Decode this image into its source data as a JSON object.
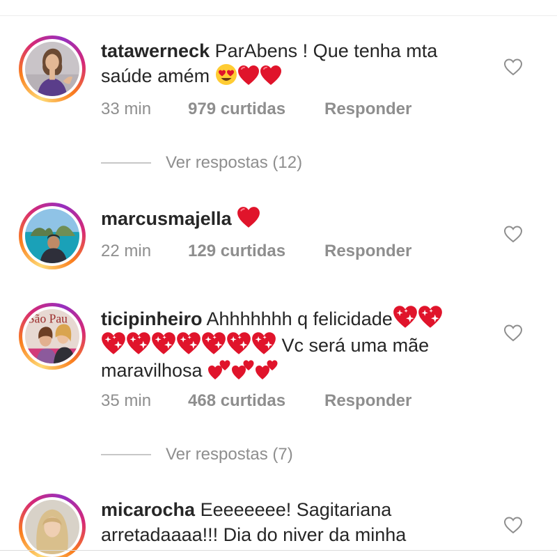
{
  "comments": [
    {
      "username": "tatawerneck",
      "text_line1": "ParAbens ! Que tenha mta",
      "text_line2": "saúde amém",
      "time": "33 min",
      "likes": "979 curtidas",
      "reply_label": "Responder",
      "view_replies": "Ver respostas (12)"
    },
    {
      "username": "marcusmajella",
      "text_line1": "",
      "time": "22 min",
      "likes": "129 curtidas",
      "reply_label": "Responder"
    },
    {
      "username": "ticipinheiro",
      "text_line1": "Ahhhhhhh q felicidade",
      "text_line2": "Vc será uma mãe",
      "text_line3": "maravilhosa",
      "avatar_text": "São Pau",
      "time": "35 min",
      "likes": "468 curtidas",
      "reply_label": "Responder",
      "view_replies": "Ver respostas (7)"
    },
    {
      "username": "micarocha",
      "text_line1": "Eeeeeeee! Sagitariana",
      "text_line2": "arretadaaaa!!! Dia do niver da minha"
    }
  ],
  "icons": {
    "like_button": "heart-outline-icon",
    "emoji_heart_eyes": "heart-eyes-emoji",
    "emoji_red_heart": "red-heart-emoji",
    "emoji_sparkling_heart": "sparkling-heart-emoji",
    "emoji_two_hearts": "two-hearts-emoji"
  },
  "colors": {
    "text": "#262626",
    "meta": "#8e8e8e",
    "heart_red": "#e0142b",
    "heart_outline": "#8e8e8e"
  }
}
